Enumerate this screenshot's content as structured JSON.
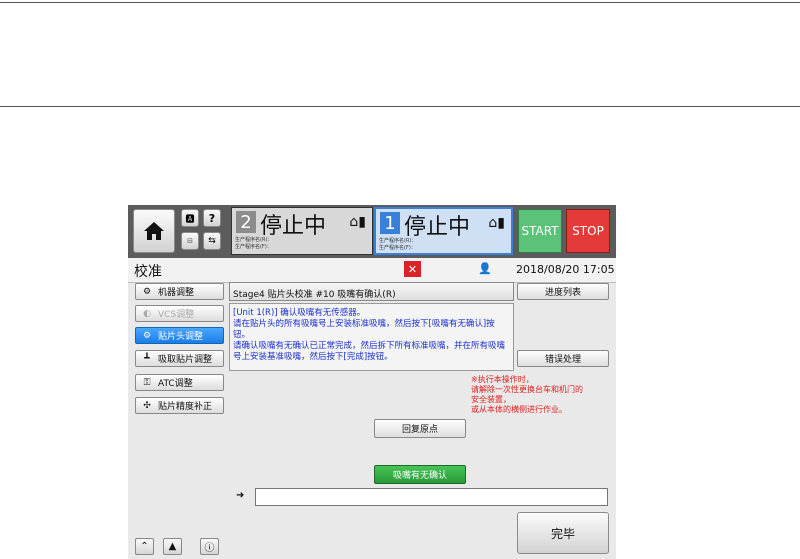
{
  "topbar": {
    "stage1": {
      "number": "2",
      "status": "停止中",
      "prog_line1": "生产程序名(R)：",
      "prog_line2": "生产程序名(F)："
    },
    "stage2": {
      "number": "1",
      "status": "停止中",
      "prog_line1": "生产程序名(R)：",
      "prog_line2": "生产程序名(F)："
    },
    "start_label": "START",
    "stop_label": "STOP"
  },
  "titlebar": {
    "title": "校准",
    "datetime": "2018/08/20 17:05"
  },
  "sidebar": {
    "items": [
      {
        "label": "机器调整",
        "state": "normal"
      },
      {
        "label": "VCS调整",
        "state": "disabled"
      },
      {
        "label": "贴片头调整",
        "state": "active"
      },
      {
        "label": "吸取贴片调整",
        "state": "normal"
      },
      {
        "label": "ATC调整",
        "state": "normal"
      },
      {
        "label": "贴片精度补正",
        "state": "normal"
      }
    ]
  },
  "main": {
    "step_header": "Stage4 贴片头校准 #10 吸嘴有确认(R)",
    "instructions": [
      "[Unit 1(R)] 确认吸嘴有无传感器。",
      "请在贴片头的所有吸嘴号上安装标准吸嘴，然后按下[吸嘴有无确认]按钮。",
      "请确认吸嘴有无确认已正常完成，然后拆下所有标准吸嘴，并在所有吸嘴号上安装基准吸嘴，然后按下[完成]按钮。"
    ],
    "progress_list_label": "进度列表",
    "error_handling_label": "错误处理",
    "warning_lines": [
      "※执行本操作时，",
      "请解除一次性更换台车和机门的",
      "安全装置，",
      "或从本体的横侧进行作业。"
    ],
    "return_origin_label": "回复原点",
    "nozzle_check_label": "吸嘴有无确认",
    "input_value": "",
    "complete_label": "完毕"
  },
  "colors": {
    "accent_blue": "#1a7ee6",
    "start_green": "#5cc27a",
    "stop_red": "#e43a3a",
    "nozzle_green": "#2fa33f",
    "warning_red": "#e02020",
    "instruction_blue": "#1b2fcf"
  }
}
